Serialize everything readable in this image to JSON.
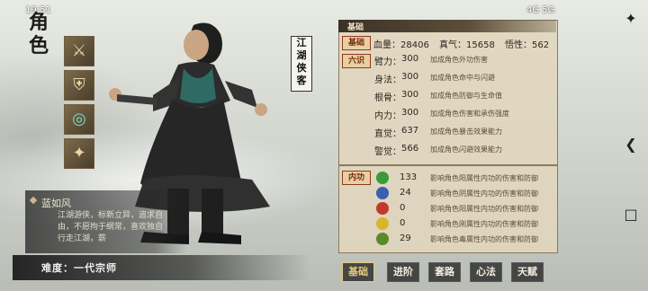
{
  "status": {
    "time": "19:51",
    "right": "4G 5G"
  },
  "title": {
    "chars": [
      "角",
      "色"
    ]
  },
  "character": {
    "name_tag": [
      "江",
      "湖",
      "侠",
      "客"
    ]
  },
  "description": {
    "name": "蓝如风",
    "text": "江湖游侠，标新立异，追求自由，不愿拘于纲常，喜欢独自行走江湖，薪"
  },
  "difficulty": "难度：一代宗师",
  "panel": {
    "header": "基础",
    "tags": {
      "basic": "基础",
      "six": "六识",
      "neigong": "内功"
    },
    "top_stats": [
      "血量：28406",
      "真气：15658",
      "悟性：562"
    ],
    "rows": [
      {
        "label": "臂力：",
        "value": "300",
        "desc": "加成角色外功伤害"
      },
      {
        "label": "身法：",
        "value": "300",
        "desc": "加成角色命中与闪避"
      },
      {
        "label": "根骨：",
        "value": "300",
        "desc": "加成角色防御与生命值"
      },
      {
        "label": "内力：",
        "value": "300",
        "desc": "加成角色伤害和承伤强度"
      },
      {
        "label": "直觉：",
        "value": "637",
        "desc": "加成角色暴击效果能力"
      },
      {
        "label": "警觉：",
        "value": "566",
        "desc": "加成角色闪避效果能力"
      }
    ],
    "neigong_rows": [
      {
        "value": "133",
        "desc": "影响角色阳属性内功的伤害和防御",
        "color": "#3a9a3a",
        "icon": "yang-icon"
      },
      {
        "value": "24",
        "desc": "影响角色阴属性内功的伤害和防御",
        "color": "#3a5fb0",
        "icon": "yin-icon"
      },
      {
        "value": "0",
        "desc": "影响角色阳属性内功的伤害和防御",
        "color": "#c23a2a",
        "icon": "fire-icon"
      },
      {
        "value": "0",
        "desc": "影响角色刚属性内功的伤害和防御",
        "color": "#d9b52a",
        "icon": "metal-icon"
      },
      {
        "value": "29",
        "desc": "影响角色毒属性内功的伤害和防御",
        "color": "#5a8a2a",
        "icon": "poison-icon"
      }
    ]
  },
  "tabs": [
    "基础",
    "进阶",
    "套路",
    "心法",
    "天赋"
  ]
}
